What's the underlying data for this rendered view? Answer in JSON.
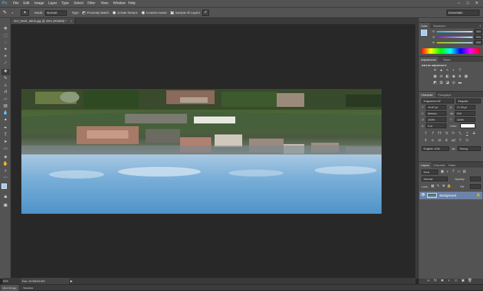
{
  "app": {
    "logo": "Ps"
  },
  "menu": [
    "File",
    "Edit",
    "Image",
    "Layer",
    "Type",
    "Select",
    "Filter",
    "View",
    "Window",
    "Help"
  ],
  "options": {
    "mode_label": "Mode:",
    "mode_value": "Normal",
    "type_label": "Type:",
    "proximity_match": "Proximity Match",
    "create_texture": "Create Texture",
    "content_aware": "Content-Aware",
    "sample_all_layers": "Sample All Layers",
    "workspace": "Essentials"
  },
  "document": {
    "tab_title": "DJI_0040_stitch.jpg @ 25% (RGB/8) *",
    "zoom": "25%",
    "doc_size": "Doc: 24.9M/24.9M"
  },
  "bottom_tabs": [
    "Mini Bridge",
    "Timeline"
  ],
  "color_panel": {
    "tabs": [
      "Color",
      "Swatches"
    ],
    "r_label": "R",
    "r_value": "163",
    "g_label": "G",
    "g_value": "204",
    "b_label": "B",
    "b_value": "255",
    "fg_color": "#a3ccff"
  },
  "adjustments_panel": {
    "tabs": [
      "Adjustments",
      "Styles"
    ],
    "heading": "Add an adjustment"
  },
  "character_panel": {
    "tabs": [
      "Character",
      "Paragraph"
    ],
    "font_family": "Engravers MT",
    "font_style": "Regular",
    "font_size": "10.67 pt",
    "leading": "17.33 pt",
    "tracking_kerning": "Metrics",
    "tracking": "915",
    "vertical_scale": "100%",
    "horizontal_scale": "100%",
    "baseline_shift": "0 pt",
    "color_label": "Color:",
    "language": "English: USA",
    "antialias": "Strong",
    "antialias_prefix": "aa"
  },
  "layers_panel": {
    "tabs": [
      "Layers",
      "Channels",
      "Paths"
    ],
    "kind": "Kind",
    "blend_mode": "Normal",
    "opacity_label": "Opacity:",
    "lock_label": "Lock:",
    "fill_label": "Fill:",
    "layer_name": "Background"
  }
}
